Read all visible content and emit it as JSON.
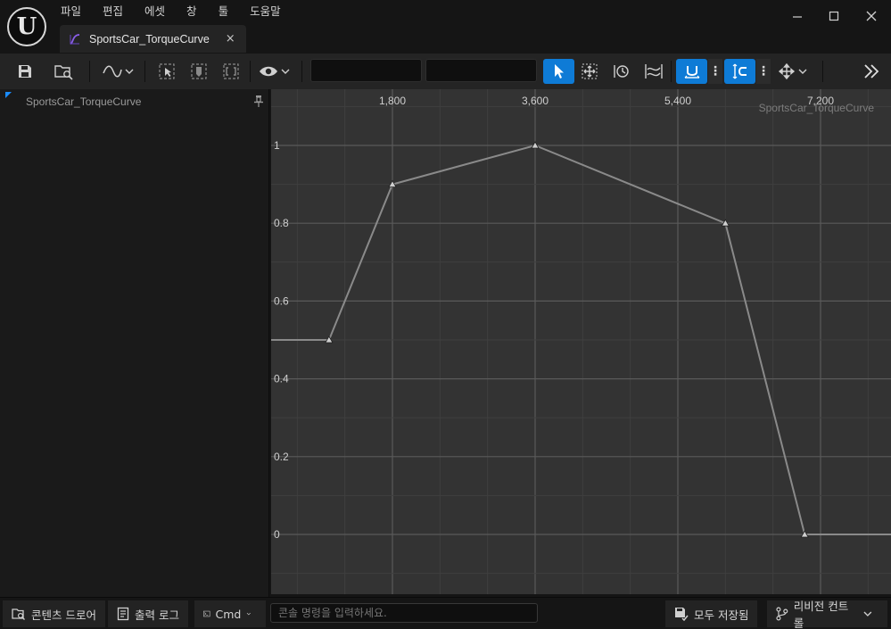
{
  "app": {
    "logo_letter": "U",
    "menu": [
      "파일",
      "편집",
      "에셋",
      "창",
      "툴",
      "도움말"
    ],
    "window_controls": [
      "minimize-icon",
      "maximize-icon",
      "close-icon"
    ]
  },
  "tab": {
    "label": "SportsCar_TorqueCurve",
    "close": "×",
    "icon": "curve-asset-icon"
  },
  "toolbar": {
    "icons": [
      "save-icon",
      "browse-asset-icon",
      "curve-type-icon",
      "select-keys-icon",
      "frame-icon",
      "fit-icon",
      "view-options-icon",
      "select-tool-icon",
      "transform-tool-icon",
      "retime-tool-icon",
      "multi-scale-icon",
      "snap-time-icon",
      "snap-value-icon",
      "axis-lock-icon",
      "expand-icon"
    ],
    "time_field": "",
    "value_field": "",
    "accent": "#0e7bd6"
  },
  "outline": {
    "curve_name": "SportsCar_TorqueCurve"
  },
  "graph": {
    "watermark": "SportsCar_TorqueCurve",
    "x_ticks": [
      "1,800",
      "3,600",
      "5,400",
      "7,200"
    ],
    "y_ticks": [
      "1",
      "0.8",
      "0.6",
      "0.4",
      "0.2",
      "0"
    ],
    "keys": [
      {
        "time": 1000,
        "value": 0.5
      },
      {
        "time": 1800,
        "value": 0.9
      },
      {
        "time": 3600,
        "value": 1.0
      },
      {
        "time": 6000,
        "value": 0.8
      },
      {
        "time": 7000,
        "value": 0.0
      }
    ],
    "curve_color": "#8a8a8a",
    "background": "#333333"
  },
  "statusbar": {
    "content_drawer": "콘텐츠 드로어",
    "output_log": "출력 로그",
    "cmd": "Cmd",
    "console_placeholder": "콘솔 명령을 입력하세요.",
    "save_all": "모두 저장됨",
    "revision_control": "리비전 컨트롤"
  }
}
